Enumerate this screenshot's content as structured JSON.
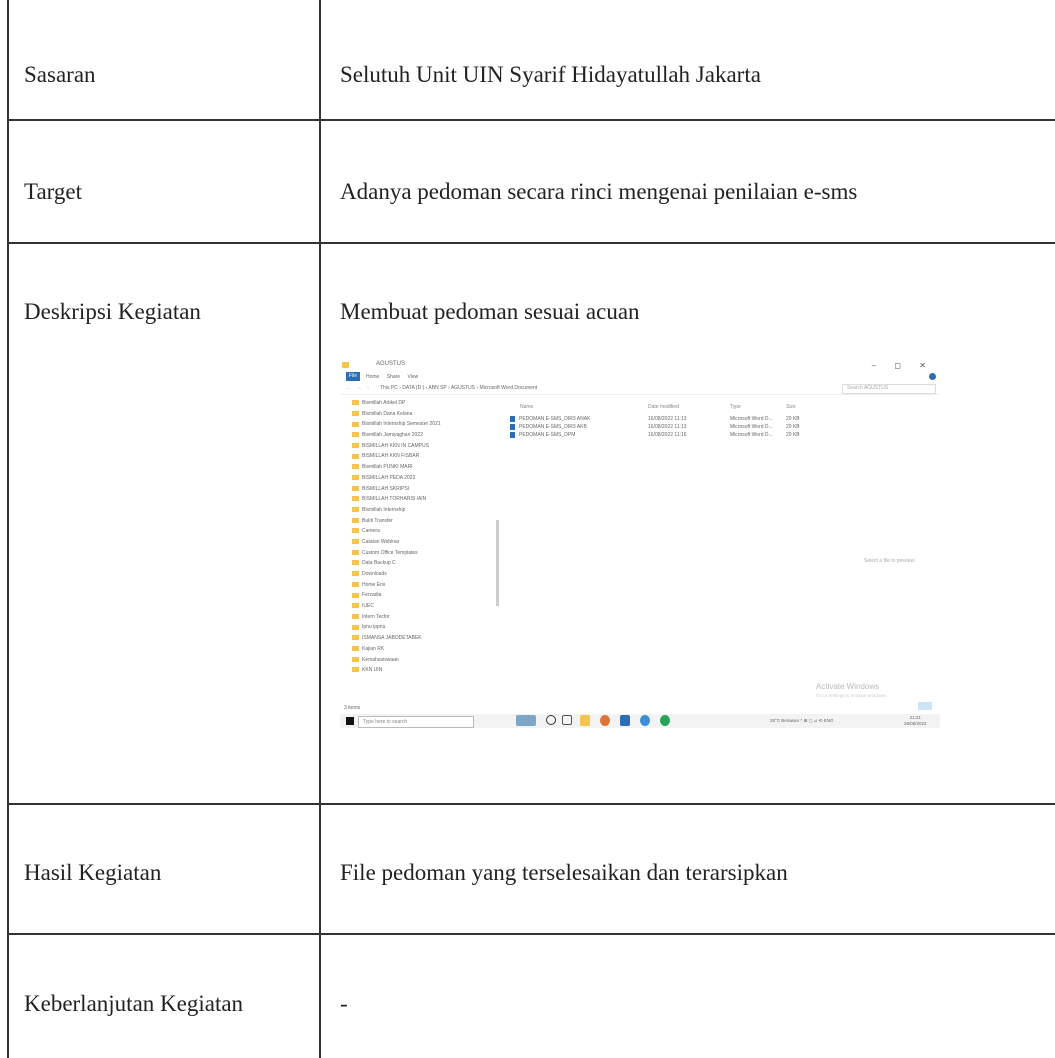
{
  "rows": [
    {
      "label": "Sasaran",
      "value": "Selutuh Unit UIN Syarif Hidayatullah Jakarta"
    },
    {
      "label": "Target",
      "value": "Adanya pedoman secara rinci mengenai penilaian e-sms"
    },
    {
      "label": "Deskripsi Kegiatan",
      "value": "Membuat pedoman sesuai acuan"
    },
    {
      "label": "Hasil Kegiatan",
      "value": "File pedoman yang terselesaikan dan terarsipkan"
    },
    {
      "label": "Keberlanjutan Kegiatan",
      "value": "-"
    }
  ],
  "screenshot": {
    "title": "AGUSTUS",
    "ribbon_file": "File",
    "ribbon_tabs": "Home Share View",
    "nav": "← → ↑",
    "path": "This PC › DATA (D:) › ABN SP › AGUSTUS › Microsoft Word Document",
    "search": "Search AGUSTUS",
    "tree": [
      "Bismillah Artikel DP",
      "Bismillah Dana Kelana",
      "Bismillah Internship Semester 2021",
      "Bismillah Jamiyaghan 2022",
      "BISMILLAH KKN IN CAMPUS",
      "BISMILLAH KKN FISBAR",
      "Bismillah PUNKI MARI",
      "BISMILLAH PEDA 2022",
      "BISMILLAH SKRIPSI",
      "BISMILLAH TORHARIS IAIN",
      "Bismillah Internship",
      "Bukti Transfer",
      "Camera",
      "Catatan Webinar",
      "Custom Office Templates",
      "Data Backup C",
      "Downloads",
      "Home Ens",
      "Ferzadia",
      "IUEC",
      "Intern Tecfor",
      "Ipnu ippnu",
      "ISMANSA JABODETABEK",
      "Kajian RK",
      "Kemahasiswaan",
      "KKN UIN"
    ],
    "headers": {
      "name": "Name",
      "date": "Date modified",
      "type": "Type",
      "size": "Size"
    },
    "files": [
      {
        "name": "PEDOMAN E-SMS_DIR3 ANAK",
        "date": "16/08/2022 11:13",
        "type": "Microsoft Word D...",
        "size": "20 KB"
      },
      {
        "name": "PEDOMAN E-SMS_DIR3 AKB",
        "date": "16/08/2022 11:13",
        "type": "Microsoft Word D...",
        "size": "20 KB"
      },
      {
        "name": "PEDOMAN E-SMS_DPM",
        "date": "16/08/2022 11:16",
        "type": "Microsoft Word D...",
        "size": "20 KB"
      }
    ],
    "preview_message": "Select a file to preview.",
    "watermark_title": "Activate Windows",
    "watermark_sub": "Go to Settings to activate Windows.",
    "status": "3 items",
    "taskbar_search": "Type here to search",
    "tray": "28°C Berawan  ^ ⊞ ◻ ⊿ ⟲ ENG",
    "time": "21:21",
    "date": "26/08/2022",
    "colors": {
      "folder": "#f3c44e",
      "accent": "#2a6fb5"
    }
  }
}
